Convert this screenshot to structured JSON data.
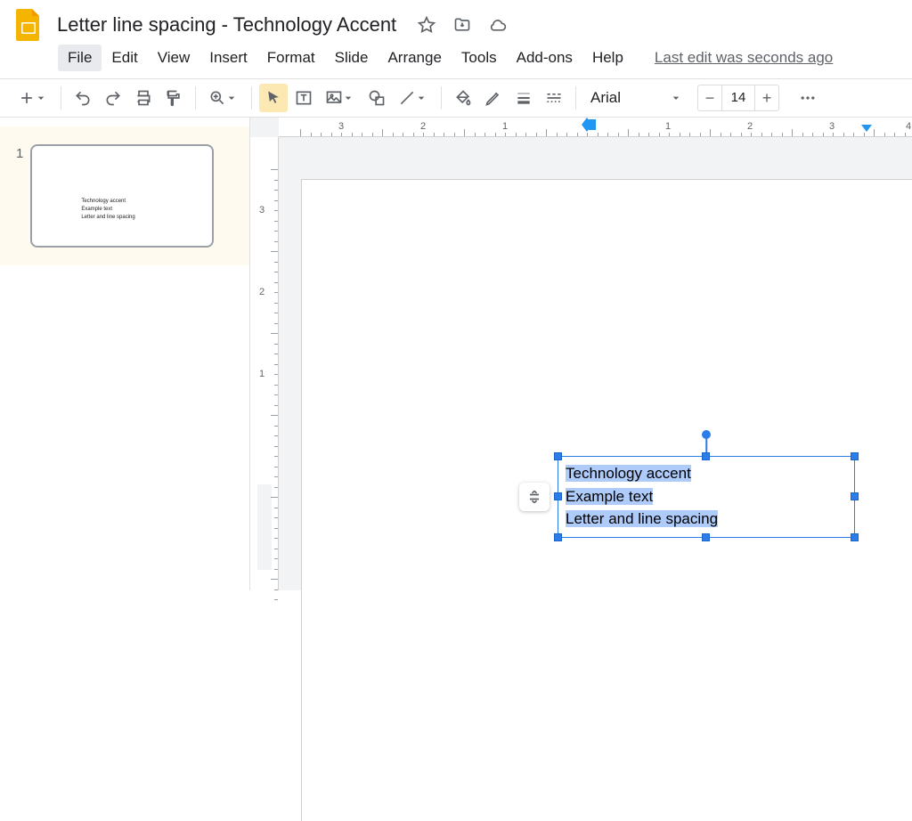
{
  "header": {
    "doc_title": "Letter line spacing - Technology Accent",
    "last_edit": "Last edit was seconds ago"
  },
  "menubar": {
    "items": [
      "File",
      "Edit",
      "View",
      "Insert",
      "Format",
      "Slide",
      "Arrange",
      "Tools",
      "Add-ons",
      "Help"
    ],
    "selected_index": 0
  },
  "toolbar": {
    "font_name": "Arial",
    "font_size": "14"
  },
  "filmstrip": {
    "slides": [
      {
        "number": "1",
        "thumb_lines": [
          "Technology accent",
          "Example text",
          "Letter and line spacing"
        ]
      }
    ]
  },
  "ruler_h": {
    "labels": [
      "3",
      "2",
      "1",
      "",
      "1",
      "2",
      "3",
      "4"
    ]
  },
  "ruler_v": {
    "labels": [
      "3",
      "2",
      "1",
      ""
    ]
  },
  "textbox": {
    "lines": [
      "Technology accent",
      "Example text",
      "Letter and line spacing"
    ]
  }
}
